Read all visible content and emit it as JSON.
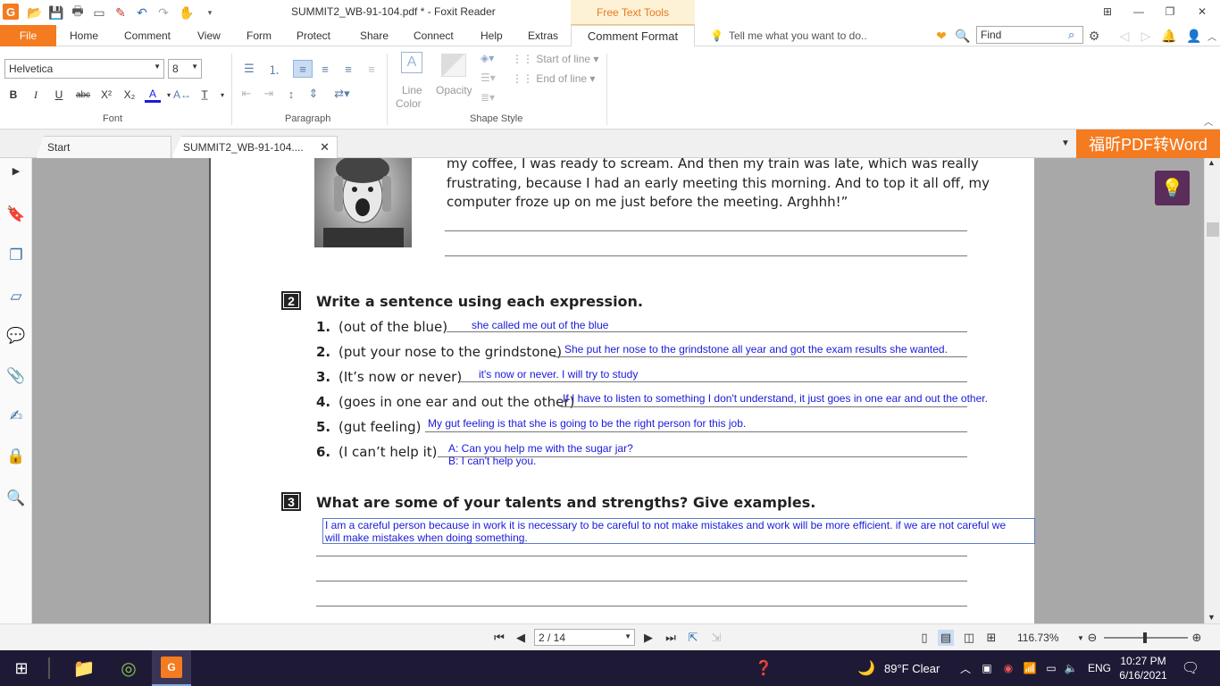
{
  "titlebar": {
    "title": "SUMMIT2_WB-91-104.pdf * - Foxit Reader",
    "contextual_tab": "Free Text Tools"
  },
  "ribbon_tabs": [
    "File",
    "Home",
    "Comment",
    "View",
    "Form",
    "Protect",
    "Share",
    "Connect",
    "Help",
    "Extras",
    "Comment Format"
  ],
  "tell_me": "Tell me what you want to do..",
  "find_placeholder": "Find",
  "ribbon": {
    "font_name": "Helvetica",
    "font_size": "8",
    "font_group": "Font",
    "paragraph_group": "Paragraph",
    "shape_group": "Shape Style",
    "line_color_label_1": "Line",
    "line_color_label_2": "Color",
    "opacity_label": "Opacity",
    "start_of_line": "Start of line",
    "end_of_line": "End of line"
  },
  "doc_tabs": {
    "start": "Start",
    "file": "SUMMIT2_WB-91-104...."
  },
  "convert_button": "福昕PDF转Word",
  "page": {
    "quote_lines": [
      "my coffee, I was ready to scream. And then my train was late, which was really",
      "frustrating, because I had an early meeting this morning. And to top it all off, my",
      "computer froze up on me just before the meeting. Arghhh!”"
    ],
    "exercise2": {
      "number": "2",
      "title": "Write a sentence using each expression.",
      "items": [
        {
          "num": "1.",
          "expr": "(out of the blue)",
          "answer": "she called me out of the blue"
        },
        {
          "num": "2.",
          "expr": "(put your nose to the grindstone)",
          "answer": "She put her nose to the grindstone all year and got the exam results she wanted."
        },
        {
          "num": "3.",
          "expr": "(It’s now or never)",
          "answer": "it's now or never. I will try to study"
        },
        {
          "num": "4.",
          "expr": "(goes in one ear and out the other)",
          "answer": "If I have to listen to something I don't understand, it just goes in one ear and out the other."
        },
        {
          "num": "5.",
          "expr": "(gut feeling)",
          "answer": "My gut feeling is that she is going to be the right person for this job."
        },
        {
          "num": "6.",
          "expr": "(I can’t help it)",
          "answer": "A: Can you help me with the sugar jar?",
          "answer2": "B: I can't help you."
        }
      ]
    },
    "exercise3": {
      "number": "3",
      "title": "What are some of your talents and strengths? Give examples.",
      "answer_line1": "I am a careful person because in work it is necessary to be careful to not make mistakes and work will be more efficient. if we are not careful we",
      "answer_line2": "will make mistakes when doing something."
    }
  },
  "statusbar": {
    "page_indicator": "2 / 14",
    "zoom": "116.73%"
  },
  "taskbar": {
    "weather": "89°F  Clear",
    "language": "ENG",
    "time": "10:27 PM",
    "date": "6/16/2021"
  },
  "colors": {
    "accent_orange": "#f47b20",
    "annotation_blue": "#1a1adb",
    "taskbar": "#1e1a36"
  }
}
